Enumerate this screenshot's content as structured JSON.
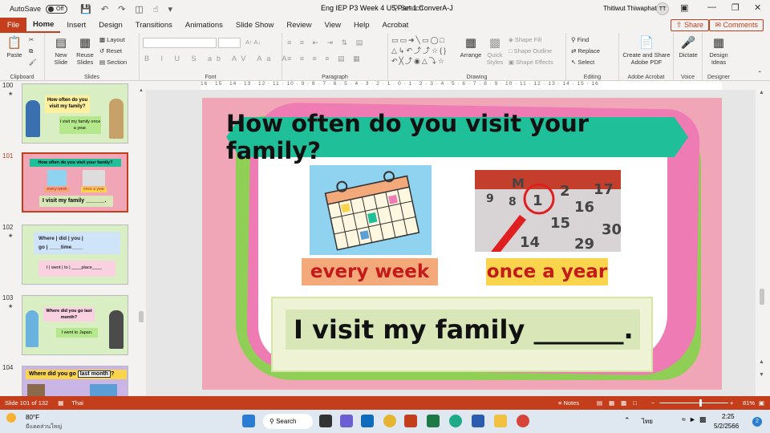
{
  "titlebar": {
    "autosave_label": "AutoSave",
    "autosave_state": "Off",
    "doc_title": "Eng IEP P3 Week 4 U5 Part 1 ConverA-J",
    "search_placeholder": "Search",
    "user_name": "Thitiwut Thiwaphat",
    "user_initials": "TT"
  },
  "tabs": [
    "File",
    "Home",
    "Insert",
    "Design",
    "Transitions",
    "Animations",
    "Slide Show",
    "Review",
    "View",
    "Help",
    "Acrobat"
  ],
  "active_tab": "Home",
  "share_label": "Share",
  "comments_label": "Comments",
  "ribbon": {
    "clipboard": {
      "label": "Clipboard",
      "paste": "Paste"
    },
    "slides": {
      "label": "Slides",
      "new_slide": "New Slide",
      "reuse_slides": "Reuse Slides",
      "layout": "Layout",
      "reset": "Reset",
      "section": "Section"
    },
    "font": {
      "label": "Font"
    },
    "paragraph": {
      "label": "Paragraph"
    },
    "drawing": {
      "label": "Drawing",
      "arrange": "Arrange",
      "quick_styles": "Quick Styles",
      "shape_fill": "Shape Fill",
      "shape_outline": "Shape Outline",
      "shape_effects": "Shape Effects"
    },
    "editing": {
      "label": "Editing",
      "find": "Find",
      "replace": "Replace",
      "select": "Select"
    },
    "adobe": {
      "label": "Adobe Acrobat",
      "create_share": "Create and Share Adobe PDF"
    },
    "voice": {
      "label": "Voice",
      "dictate": "Dictate"
    },
    "designer": {
      "label": "Designer",
      "design_ideas": "Design Ideas"
    }
  },
  "ruler_text": "16 · 15 · 14 · 13 · 12 · 11 · 10 · 9 · 8 · 7 · 6 · 5 · 4 · 3 · 2 · 1 · 0 · 1 · 2 · 3 · 4 · 5 · 6 · 7 · 8 · 9 · 10 · 11 · 12 · 13 · 14 · 15 · 16",
  "thumbnails": [
    {
      "num": "100",
      "q": "How often do you visit my family?",
      "a": "I visit my family once a year."
    },
    {
      "num": "101",
      "q": "How often do you visit your family?",
      "a1": "every week",
      "a2": "once a year",
      "s": "I visit my family ______."
    },
    {
      "num": "102",
      "w1": "Where",
      "w2": "did",
      "w3": "you",
      "w4": "go",
      "w5": "____time____",
      "s1": "I",
      "s2": "went",
      "s3": "to",
      "s4": "____place____"
    },
    {
      "num": "103",
      "q": "Where did you go last month?",
      "a": "I went to Japan."
    },
    {
      "num": "104",
      "q": "Where did you go",
      "b": "last month",
      "tail": "?"
    }
  ],
  "slide": {
    "question": "How often do you visit your family?",
    "label_left": "every week",
    "label_right": "once a year",
    "sentence": "I visit my family _______."
  },
  "calendar_numbers": [
    "M",
    "1",
    "2",
    "17",
    "8",
    "9",
    "16",
    "15",
    "14",
    "29",
    "30"
  ],
  "status": {
    "slide_info": "Slide 101 of 132",
    "language": "Thai",
    "notes": "Notes",
    "zoom": "81%"
  },
  "taskbar": {
    "weather_temp": "80°F",
    "weather_desc": "มีแดดส่วนใหญ่",
    "search": "Search",
    "lang": "ไทย",
    "time": "2:25",
    "date": "5/2/2566",
    "badge": "2"
  },
  "colors": {
    "accent": "#c43e1c",
    "banner": "#1fbf9a",
    "slide_bg": "#f0a6b7"
  }
}
